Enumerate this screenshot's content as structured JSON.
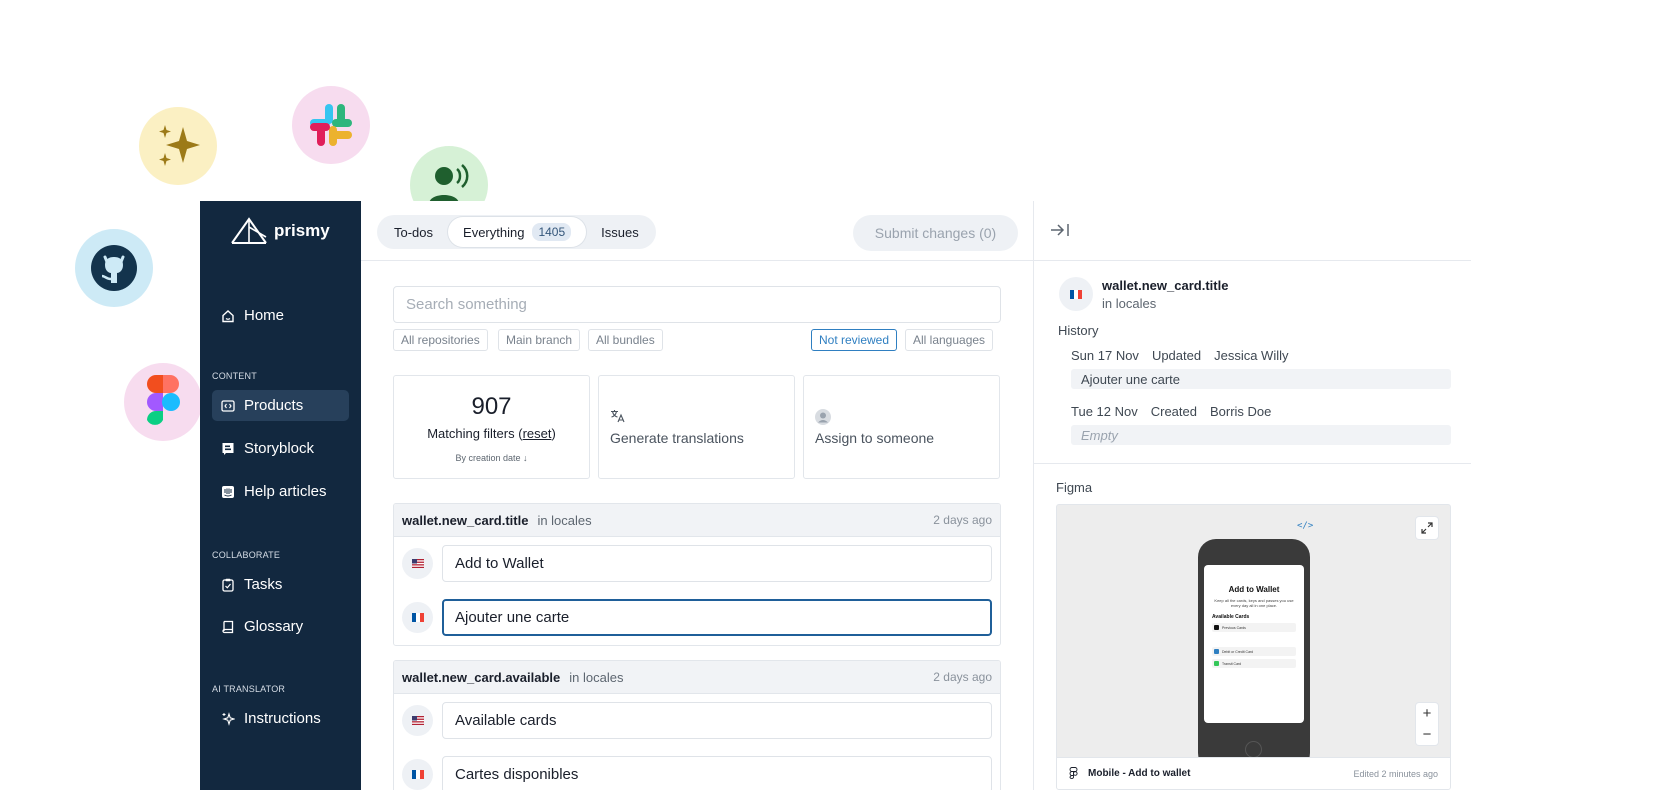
{
  "app": {
    "name": "prismy"
  },
  "sidebar": {
    "home": "Home",
    "sections": {
      "content": "CONTENT",
      "collaborate": "COLLABORATE",
      "ai": "AI TRANSLATOR"
    },
    "items": [
      {
        "label": "Products",
        "icon": "code-box-icon",
        "active": true
      },
      {
        "label": "Storyblock",
        "icon": "storyblock-icon"
      },
      {
        "label": "Help articles",
        "icon": "intercom-icon"
      },
      {
        "label": "Tasks",
        "icon": "clipboard-check-icon"
      },
      {
        "label": "Glossary",
        "icon": "book-icon"
      },
      {
        "label": "Instructions",
        "icon": "sparkles-icon"
      }
    ]
  },
  "topbar": {
    "tabs": [
      {
        "label": "To-dos"
      },
      {
        "label": "Everything",
        "count": "1405",
        "active": true
      },
      {
        "label": "Issues"
      }
    ],
    "submit_label": "Submit changes (0)"
  },
  "search": {
    "placeholder": "Search something"
  },
  "filters": {
    "repositories": "All repositories",
    "branch": "Main branch",
    "bundles": "All bundles",
    "review": "Not reviewed",
    "languages": "All languages"
  },
  "stats": {
    "count": "907",
    "label_prefix": "Matching filters (",
    "reset": "reset",
    "label_suffix": ")",
    "sort": "By creation date ↓",
    "generate": "Generate translations",
    "assign": "Assign to someone"
  },
  "entries": [
    {
      "key": "wallet.new_card.title",
      "scope": "in locales",
      "time": "2 days ago",
      "en": "Add to Wallet",
      "fr": "Ajouter une carte"
    },
    {
      "key": "wallet.new_card.available",
      "scope": "in locales",
      "time": "2 days ago",
      "en": "Available cards",
      "fr": "Cartes disponibles"
    }
  ],
  "panel": {
    "key": "wallet.new_card.title",
    "scope": "in locales",
    "history_title": "History",
    "history": [
      {
        "date": "Sun 17 Nov",
        "action": "Updated",
        "user": "Jessica Willy",
        "value": "Ajouter une carte"
      },
      {
        "date": "Tue 12 Nov",
        "action": "Created",
        "user": "Borris Doe",
        "value": "Empty"
      }
    ],
    "figma_title": "Figma",
    "figma": {
      "frame_name": "Mobile - Add to wallet",
      "edited": "Edited 2 minutes ago",
      "code_tag": "</>",
      "mock": {
        "title": "Add to Wallet",
        "subtitle": "Keep all the cards, keys and passes you use every day all in one place.",
        "section": "Available Cards",
        "rows": [
          "Previous Cards",
          "Debit or Credit Card",
          "Transit Card"
        ]
      }
    }
  },
  "colors": {
    "sidebar": "#12283f",
    "accent": "#2f7fc1",
    "focus": "#1f5f99"
  }
}
